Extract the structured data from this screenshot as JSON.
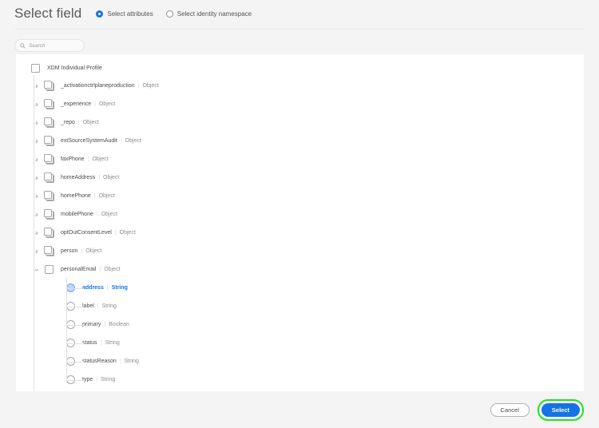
{
  "header": {
    "title": "Select field",
    "mode_options": [
      {
        "label": "Select attributes",
        "selected": true
      },
      {
        "label": "Select identity namespace",
        "selected": false
      }
    ]
  },
  "search": {
    "placeholder": "Search",
    "value": "",
    "icon": "search-icon"
  },
  "tree": {
    "root": {
      "label": "XDM Individual Profile",
      "node_type": "checkbox",
      "expanded": true
    },
    "nodes": [
      {
        "label": "_activationctrlplaneproduction",
        "type": "Object",
        "expanded": false,
        "icon": "stacked-checkbox-icon"
      },
      {
        "label": "_experience",
        "type": "Object",
        "expanded": false,
        "icon": "stacked-checkbox-icon"
      },
      {
        "label": "_repo",
        "type": "Object",
        "expanded": false,
        "icon": "stacked-checkbox-icon"
      },
      {
        "label": "extSourceSystemAudit",
        "type": "Object",
        "expanded": false,
        "icon": "stacked-checkbox-icon"
      },
      {
        "label": "faxPhone",
        "type": "Object",
        "expanded": false,
        "icon": "stacked-checkbox-icon"
      },
      {
        "label": "homeAddress",
        "type": "Object",
        "expanded": false,
        "icon": "stacked-checkbox-icon"
      },
      {
        "label": "homePhone",
        "type": "Object",
        "expanded": false,
        "icon": "stacked-checkbox-icon"
      },
      {
        "label": "mobilePhone",
        "type": "Object",
        "expanded": false,
        "icon": "stacked-checkbox-icon"
      },
      {
        "label": "optOutConsentLevel",
        "type": "Object",
        "expanded": false,
        "icon": "stacked-checkbox-icon"
      },
      {
        "label": "person",
        "type": "Object",
        "expanded": false,
        "icon": "stacked-checkbox-icon"
      },
      {
        "label": "personalEmail",
        "type": "Object",
        "expanded": true,
        "icon": "checkbox-icon"
      }
    ],
    "personal_email_children": [
      {
        "label": "address",
        "type": "String",
        "selected": true
      },
      {
        "label": "label",
        "type": "String",
        "selected": false
      },
      {
        "label": "primary",
        "type": "Boolean",
        "selected": false
      },
      {
        "label": "status",
        "type": "String",
        "selected": false
      },
      {
        "label": "statusReason",
        "type": "String",
        "selected": false
      },
      {
        "label": "type",
        "type": "String",
        "selected": false
      }
    ],
    "clipped_node": {
      "label": "",
      "type": ""
    },
    "type_separator": "|"
  },
  "footer": {
    "cancel_label": "Cancel",
    "select_label": "Select"
  },
  "colors": {
    "accent": "#1473e6",
    "highlight_ring": "#19e619",
    "page_background": "#f4f4f4",
    "panel_background": "#ffffff",
    "line": "#e0e0e0"
  }
}
